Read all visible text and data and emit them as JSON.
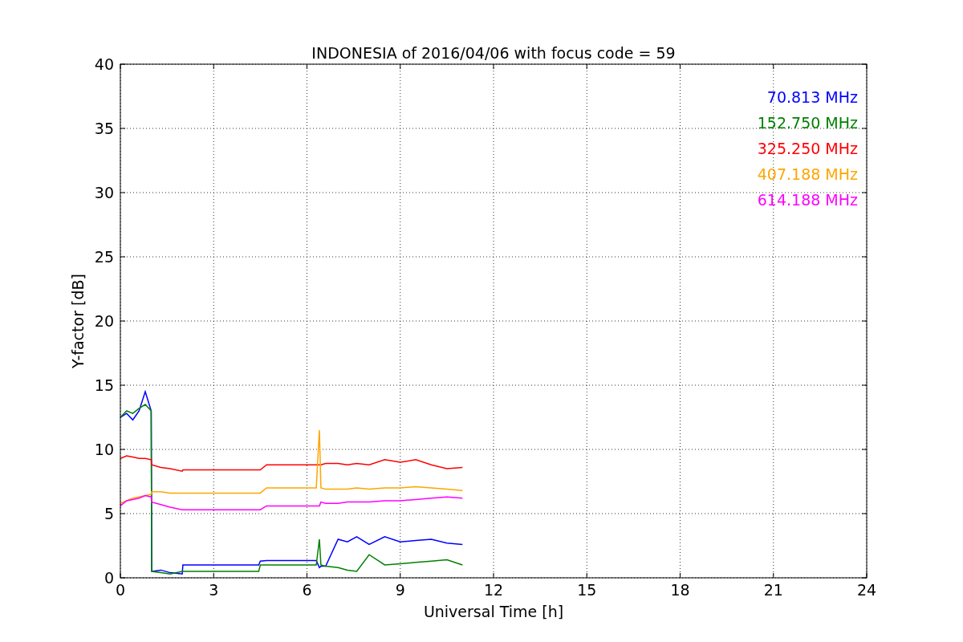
{
  "chart_data": {
    "type": "line",
    "title": "INDONESIA of 2016/04/06 with focus code = 59",
    "xlabel": "Universal Time [h]",
    "ylabel": "Y-factor [dB]",
    "xlim": [
      0,
      24
    ],
    "ylim": [
      0,
      40
    ],
    "xticks": [
      0,
      3,
      6,
      9,
      12,
      15,
      18,
      21,
      24
    ],
    "yticks": [
      0,
      5,
      10,
      15,
      20,
      25,
      30,
      35,
      40
    ],
    "grid": true,
    "x": [
      0,
      0.2,
      0.4,
      0.6,
      0.8,
      0.99,
      1.01,
      1.3,
      1.6,
      1.99,
      2.01,
      4.45,
      4.5,
      4.7,
      6.3,
      6.4,
      6.45,
      6.6,
      7.0,
      7.3,
      7.6,
      8.0,
      8.5,
      9.0,
      9.5,
      10.0,
      10.5,
      11.0
    ],
    "series": [
      {
        "name": "70.813 MHz",
        "color": "#0000ff",
        "values": [
          12.5,
          12.8,
          12.3,
          13,
          14.5,
          13,
          0.5,
          0.6,
          0.4,
          0.3,
          1.0,
          1.0,
          1.3,
          1.35,
          1.35,
          0.8,
          0.9,
          0.9,
          3.0,
          2.8,
          3.2,
          2.6,
          3.2,
          2.8,
          2.9,
          3.0,
          2.7,
          2.6
        ]
      },
      {
        "name": "152.750 MHz",
        "color": "#008000",
        "values": [
          12.5,
          13,
          12.8,
          13.2,
          13.5,
          13,
          0.5,
          0.4,
          0.3,
          0.5,
          0.5,
          0.5,
          1.0,
          1.0,
          1.0,
          3.0,
          1.0,
          0.9,
          0.8,
          0.6,
          0.5,
          1.8,
          1.0,
          1.1,
          1.2,
          1.3,
          1.4,
          1.0
        ]
      },
      {
        "name": "325.250 MHz",
        "color": "#ff0000",
        "values": [
          9.3,
          9.5,
          9.4,
          9.3,
          9.3,
          9.2,
          8.8,
          8.6,
          8.5,
          8.3,
          8.4,
          8.4,
          8.4,
          8.8,
          8.8,
          8.8,
          8.8,
          8.9,
          8.9,
          8.8,
          8.9,
          8.8,
          9.2,
          9.0,
          9.2,
          8.8,
          8.5,
          8.6
        ]
      },
      {
        "name": "407.188 MHz",
        "color": "#ffa500",
        "values": [
          5.8,
          6.0,
          6.2,
          6.3,
          6.4,
          6.5,
          6.7,
          6.7,
          6.6,
          6.6,
          6.6,
          6.6,
          6.6,
          7.0,
          7.0,
          11.5,
          7.0,
          6.9,
          6.9,
          6.9,
          7.0,
          6.9,
          7.0,
          7.0,
          7.1,
          7.0,
          6.9,
          6.8
        ]
      },
      {
        "name": "614.188 MHz",
        "color": "#ff00ff",
        "values": [
          5.6,
          6.0,
          6.1,
          6.2,
          6.4,
          6.3,
          5.9,
          5.7,
          5.5,
          5.3,
          5.3,
          5.3,
          5.3,
          5.6,
          5.6,
          5.6,
          5.9,
          5.8,
          5.8,
          5.9,
          5.9,
          5.9,
          6.0,
          6.0,
          6.1,
          6.2,
          6.3,
          6.2
        ]
      }
    ]
  }
}
